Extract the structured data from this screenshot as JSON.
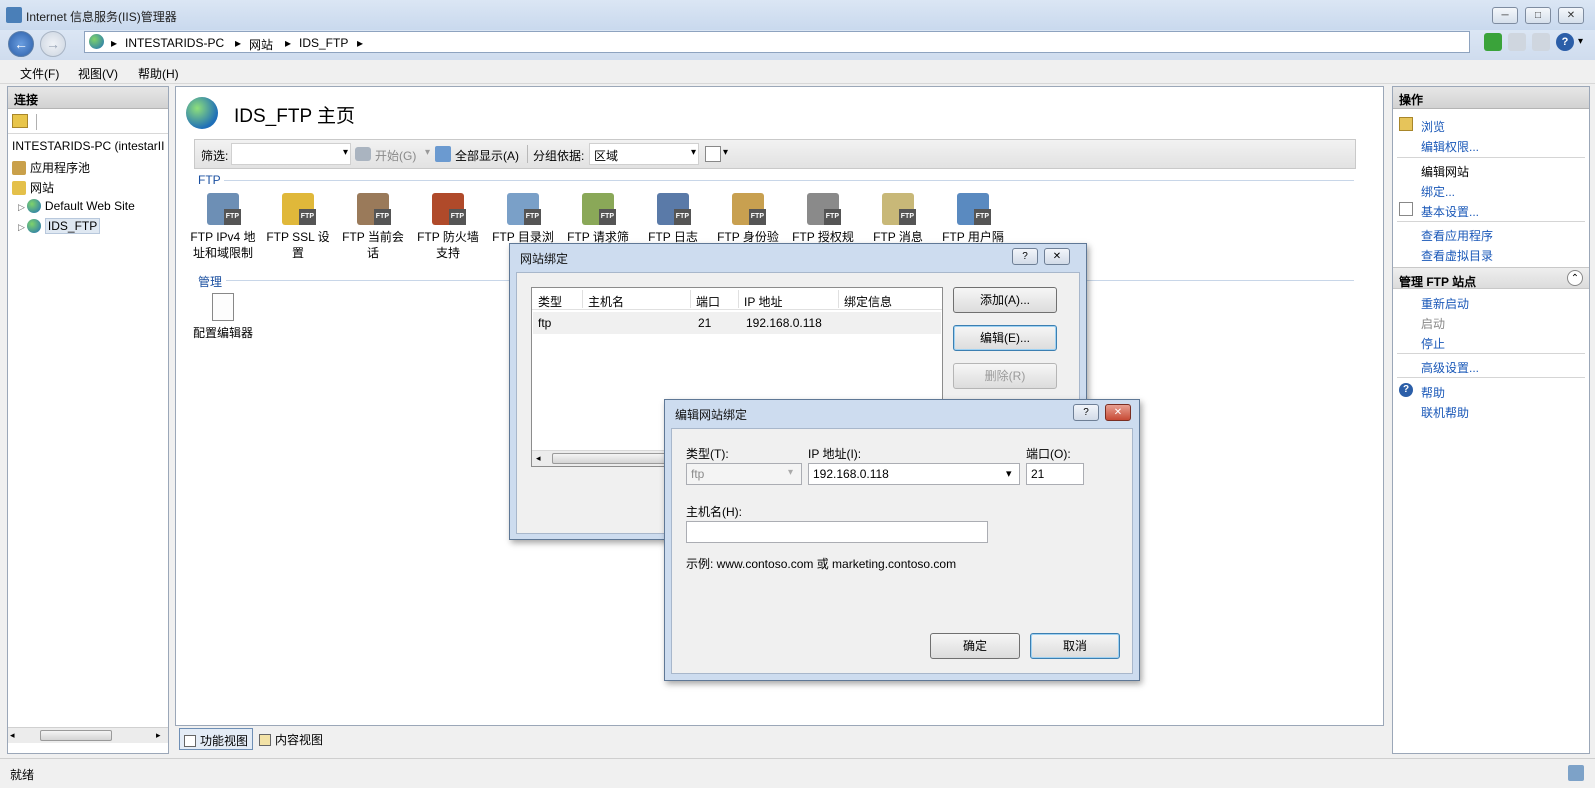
{
  "window": {
    "title": "Internet 信息服务(IIS)管理器",
    "controls": [
      "─",
      "□",
      "✕"
    ]
  },
  "address": {
    "crumbs": [
      "INTESTARIDS-PC",
      "网站",
      "IDS_FTP"
    ],
    "sep": "▸"
  },
  "menu": {
    "file": "文件(F)",
    "view": "视图(V)",
    "help": "帮助(H)"
  },
  "connections": {
    "header": "连接",
    "tree": [
      "INTESTARIDS-PC (intestarII",
      "应用程序池",
      "网站",
      "Default Web Site",
      "IDS_FTP"
    ]
  },
  "center": {
    "page_title": "IDS_FTP 主页",
    "filter_label": "筛选:",
    "start_label": "开始(G)",
    "showall_label": "全部显示(A)",
    "groupby_label": "分组依据:",
    "groupby_value": "区域",
    "group_ftp": "FTP",
    "group_manage": "管理",
    "features": [
      {
        "line1": "FTP IPv4 地",
        "line2": "址和域限制"
      },
      {
        "line1": "FTP SSL 设",
        "line2": "置"
      },
      {
        "line1": "FTP 当前会",
        "line2": "话"
      },
      {
        "line1": "FTP 防火墙",
        "line2": "支持"
      },
      {
        "line1": "FTP 目录浏",
        "line2": ""
      },
      {
        "line1": "FTP 请求筛",
        "line2": ""
      },
      {
        "line1": "FTP 日志",
        "line2": ""
      },
      {
        "line1": "FTP 身份验",
        "line2": ""
      },
      {
        "line1": "FTP 授权规",
        "line2": ""
      },
      {
        "line1": "FTP 消息",
        "line2": ""
      },
      {
        "line1": "FTP 用户隔",
        "line2": ""
      }
    ],
    "manage_features": [
      {
        "line1": "配置编辑器"
      }
    ],
    "badge": "FTP"
  },
  "view_tabs": {
    "features": "功能视图",
    "content": "内容视图"
  },
  "actions": {
    "header": "操作",
    "browse": "浏览",
    "edit_perms": "编辑权限...",
    "edit_site": "编辑网站",
    "bindings": "绑定...",
    "basic_settings": "基本设置...",
    "view_apps": "查看应用程序",
    "view_vdirs": "查看虚拟目录",
    "manage_ftp": "管理 FTP 站点",
    "restart": "重新启动",
    "start": "启动",
    "stop": "停止",
    "advanced": "高级设置...",
    "help": "帮助",
    "online_help": "联机帮助"
  },
  "status": {
    "text": "就绪"
  },
  "bindings_dialog": {
    "title": "网站绑定",
    "columns": [
      "类型",
      "主机名",
      "端口",
      "IP 地址",
      "绑定信息"
    ],
    "rows": [
      {
        "type": "ftp",
        "host": "",
        "port": "21",
        "ip": "192.168.0.118",
        "info": ""
      }
    ],
    "add": "添加(A)...",
    "edit": "编辑(E)...",
    "remove": "删除(R)"
  },
  "edit_dialog": {
    "title": "编辑网站绑定",
    "type_label": "类型(T):",
    "type_value": "ftp",
    "ip_label": "IP 地址(I):",
    "ip_value": "192.168.0.118",
    "port_label": "端口(O):",
    "port_value": "21",
    "host_label": "主机名(H):",
    "host_value": "",
    "example": "示例: www.contoso.com 或 marketing.contoso.com",
    "ok": "确定",
    "cancel": "取消",
    "help_btn": "?",
    "close_btn": "✕"
  },
  "icons": {
    "back": "←",
    "forward": "→",
    "dropdown": "▾",
    "collapse": "⌃",
    "expand": "▷"
  }
}
